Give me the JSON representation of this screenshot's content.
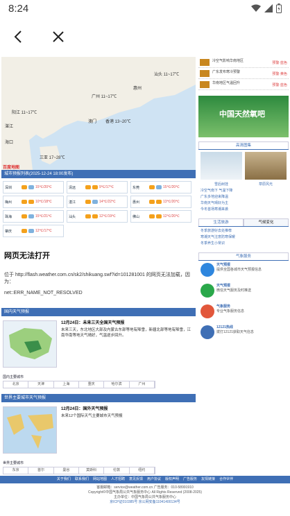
{
  "status": {
    "time": "8:24"
  },
  "map": {
    "labels": [
      "广州 11~17℃",
      "阳江 11~17℃",
      "湛江",
      "澳门",
      "香港 13~20℃",
      "海口",
      "三亚 17~28℃",
      "惠州",
      "汕头 11~17℃"
    ],
    "corner": "百度地图"
  },
  "city_header": "城市预报列表(2025-12-24 18:00发布)",
  "cities": [
    {
      "name": "深圳",
      "temp": "15℃/20℃"
    },
    {
      "name": "清远",
      "temp": "9℃/17℃"
    },
    {
      "name": "东莞",
      "temp": "15℃/20℃"
    },
    {
      "name": "梅州",
      "temp": "10℃/18℃"
    },
    {
      "name": "湛江",
      "temp": "14℃/22℃"
    },
    {
      "name": "惠州",
      "temp": "13℃/20℃"
    },
    {
      "name": "珠海",
      "temp": "15℃/21℃"
    },
    {
      "name": "汕头",
      "temp": "12℃/19℃"
    },
    {
      "name": "佛山",
      "temp": "12℃/20℃"
    },
    {
      "name": "肇庆",
      "temp": "12℃/17℃"
    }
  ],
  "error": {
    "title": "网页无法打开",
    "line1": "位于 http://flash.weather.com.cn/sk2/shikuang.swf?id=101281001 的网页无法加载，因为：",
    "line2": "net::ERR_NAME_NOT_RESOLVED"
  },
  "domestic": {
    "header": "国内天气预报",
    "date": "12月24日：未来三天全国天气预报",
    "text": "未来三天，东北地区大部及内蒙古东部等地有降雪，新疆北部等地有降雪，江南华南等地天气晴好，气温逐步回升。",
    "tag": "国内主要城市",
    "grid": [
      "北京",
      "天津",
      "上海",
      "重庆",
      "哈尔滨",
      "广州"
    ]
  },
  "world": {
    "header": "世界主要城市天气预报",
    "date": "12月24日：国外天气预报",
    "text": "未来12个国际天气主要城市天气预报",
    "tag": "世界主要城市",
    "grid": [
      "东京",
      "首尔",
      "曼谷",
      "莫斯科",
      "伦敦",
      "纽约"
    ]
  },
  "right": {
    "news": [
      {
        "text": "冷空气影响华南地区",
        "state": "预警·蓝色"
      },
      {
        "text": "广东发布寒冷预警",
        "state": "预警·黄色"
      },
      {
        "text": "华南地区气温回升",
        "state": "预警·蓝色"
      }
    ],
    "banner_title": "中国天然氧吧",
    "tabs1": [
      "高清图集"
    ],
    "pic_caps": [
      "雪后树挂",
      "草原风光"
    ],
    "list1": [
      "冷空气南下 气温下降",
      "广东多地迎来降温",
      "华南天气晴好为主",
      "今冬首场寒潮来袭"
    ],
    "tabs2": [
      "生活旅游",
      "气候变化"
    ],
    "list2": [
      "冬季旅游好去处推荐",
      "寒潮天气注意防寒保暖",
      "冬季养生小常识"
    ],
    "service_title": "气象服务",
    "services": [
      {
        "name": "天气预报",
        "desc": "提供全国各城市天气预报信息"
      },
      {
        "name": "天气预报",
        "desc": "微信天气服务及时推送"
      },
      {
        "name": "气象服务",
        "desc": "专业气象服务信息"
      },
      {
        "name": "12121热线",
        "desc": "拨打12121获取天气信息"
      }
    ]
  },
  "footer": {
    "nav": [
      "关于我们",
      "联系我们",
      "网站地图",
      "人才招聘",
      "意见反馈",
      "用户协议",
      "版权声明",
      "广告服务",
      "友情链接",
      "合作伙伴"
    ],
    "lines": [
      "客服邮箱：service@weather.com.cn  广告服务：010-58991910",
      "Copyright©中国气象局公共气象服务中心 All Rights Reserved (2008-2025)",
      "主办单位：中国气象局公共气象服务中心",
      "京ICP证010385号  京公网安备11041400134号"
    ]
  }
}
